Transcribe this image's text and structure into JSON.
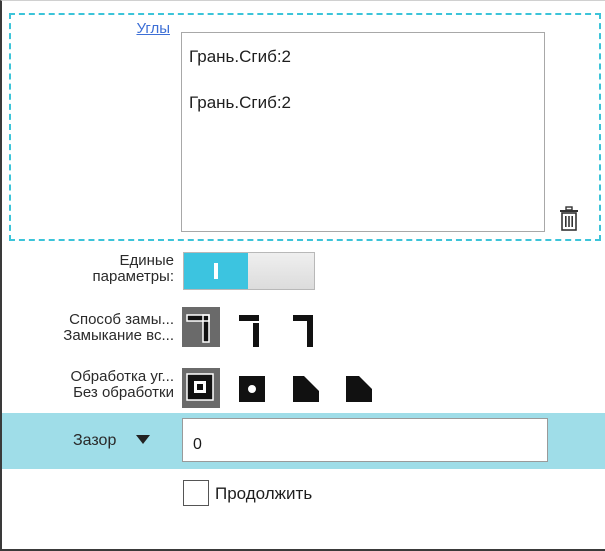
{
  "corners": {
    "link_label": "Углы",
    "items": [
      "Грань.Сгиб:2",
      "Грань.Сгиб:2"
    ],
    "delete_icon": "trash-icon"
  },
  "unified_params": {
    "label_line1": "Единые",
    "label_line2": "параметры:",
    "toggle_state": "on",
    "toggle_glyph": "I"
  },
  "closure": {
    "label": "Способ замы...",
    "value": "Замыкание вс...",
    "options": [
      "closure-full-icon",
      "closure-overlap-icon",
      "closure-miter-icon"
    ],
    "selected_index": 0
  },
  "corner_processing": {
    "label": "Обработка уг...",
    "value": "Без обработки",
    "options": [
      "no-processing-icon",
      "round-relief-icon",
      "triangle-relief-icon",
      "corner-relief-icon"
    ],
    "selected_index": 0
  },
  "gap": {
    "label": "Зазор",
    "value": "0",
    "dropdown_icon": "triangle-down-icon"
  },
  "continue": {
    "label": "Продолжить",
    "checked": false
  },
  "colors": {
    "accent": "#3cc4e0",
    "row_highlight": "#9fdde8",
    "link": "#3d6fd6",
    "dashed_border": "#3cc4d9"
  }
}
